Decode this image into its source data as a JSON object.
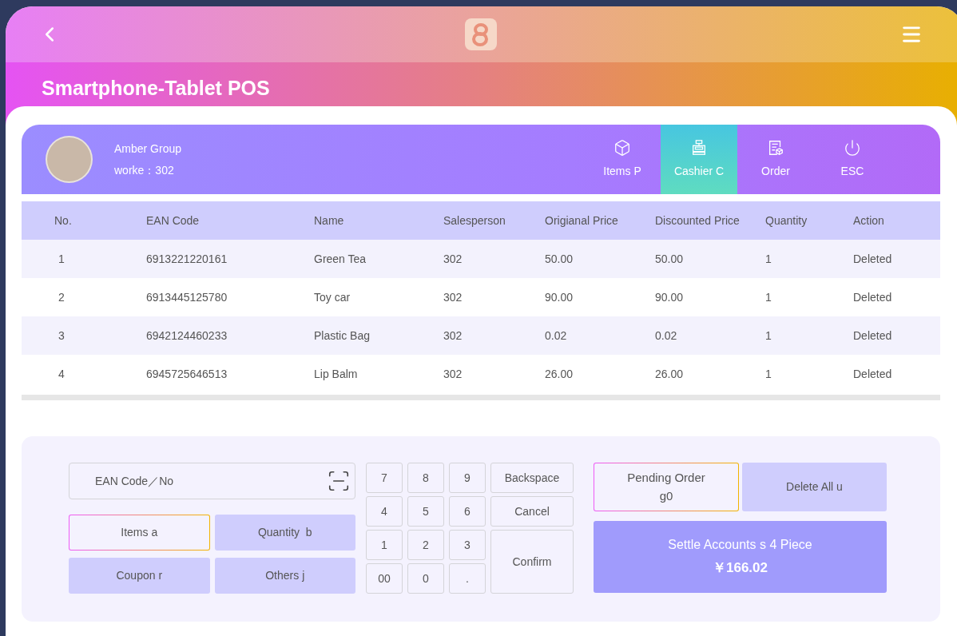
{
  "app": {
    "title": "Smartphone-Tablet POS"
  },
  "user": {
    "group": "Amber Group",
    "worker": "worke：302"
  },
  "nav": [
    {
      "label": "Items P",
      "selected": false
    },
    {
      "label": "Cashier C",
      "selected": true
    },
    {
      "label": "Order",
      "selected": false
    },
    {
      "label": "ESC",
      "selected": false
    }
  ],
  "table": {
    "columns": [
      "No.",
      "EAN Code",
      "Name",
      "Salesperson",
      "Origianal Price",
      "Discounted Price",
      "Quantity",
      "Action"
    ],
    "rows": [
      [
        "1",
        "6913221220161",
        "Green Tea",
        "302",
        "50.00",
        "50.00",
        "1",
        "Deleted"
      ],
      [
        "2",
        "6913445125780",
        "Toy car",
        "302",
        "90.00",
        "90.00",
        "1",
        "Deleted"
      ],
      [
        "3",
        "6942124460233",
        "Plastic Bag",
        "302",
        "0.02",
        "0.02",
        "1",
        "Deleted"
      ],
      [
        "4",
        "6945725646513",
        "Lip Balm",
        "302",
        "26.00",
        "26.00",
        "1",
        "Deleted"
      ]
    ]
  },
  "search": {
    "placeholder": "EAN Code／No"
  },
  "modes": [
    {
      "label": "Items a",
      "selected": true
    },
    {
      "label": "Quantity  b",
      "selected": false
    },
    {
      "label": "Coupon r",
      "selected": false
    },
    {
      "label": "Others j",
      "selected": false
    }
  ],
  "keypad": {
    "keys": [
      "7",
      "8",
      "9",
      "4",
      "5",
      "6",
      "1",
      "2",
      "3",
      "00",
      "0",
      "."
    ],
    "backspace": "Backspace",
    "cancel": "Cancel",
    "confirm": "Confirm"
  },
  "pending": {
    "label": "Pending Order",
    "code": "g0",
    "selected": true
  },
  "delete_all": "Delete All u",
  "settle": {
    "label": "Settle Accounts s 4 Piece",
    "total": "￥166.02"
  }
}
